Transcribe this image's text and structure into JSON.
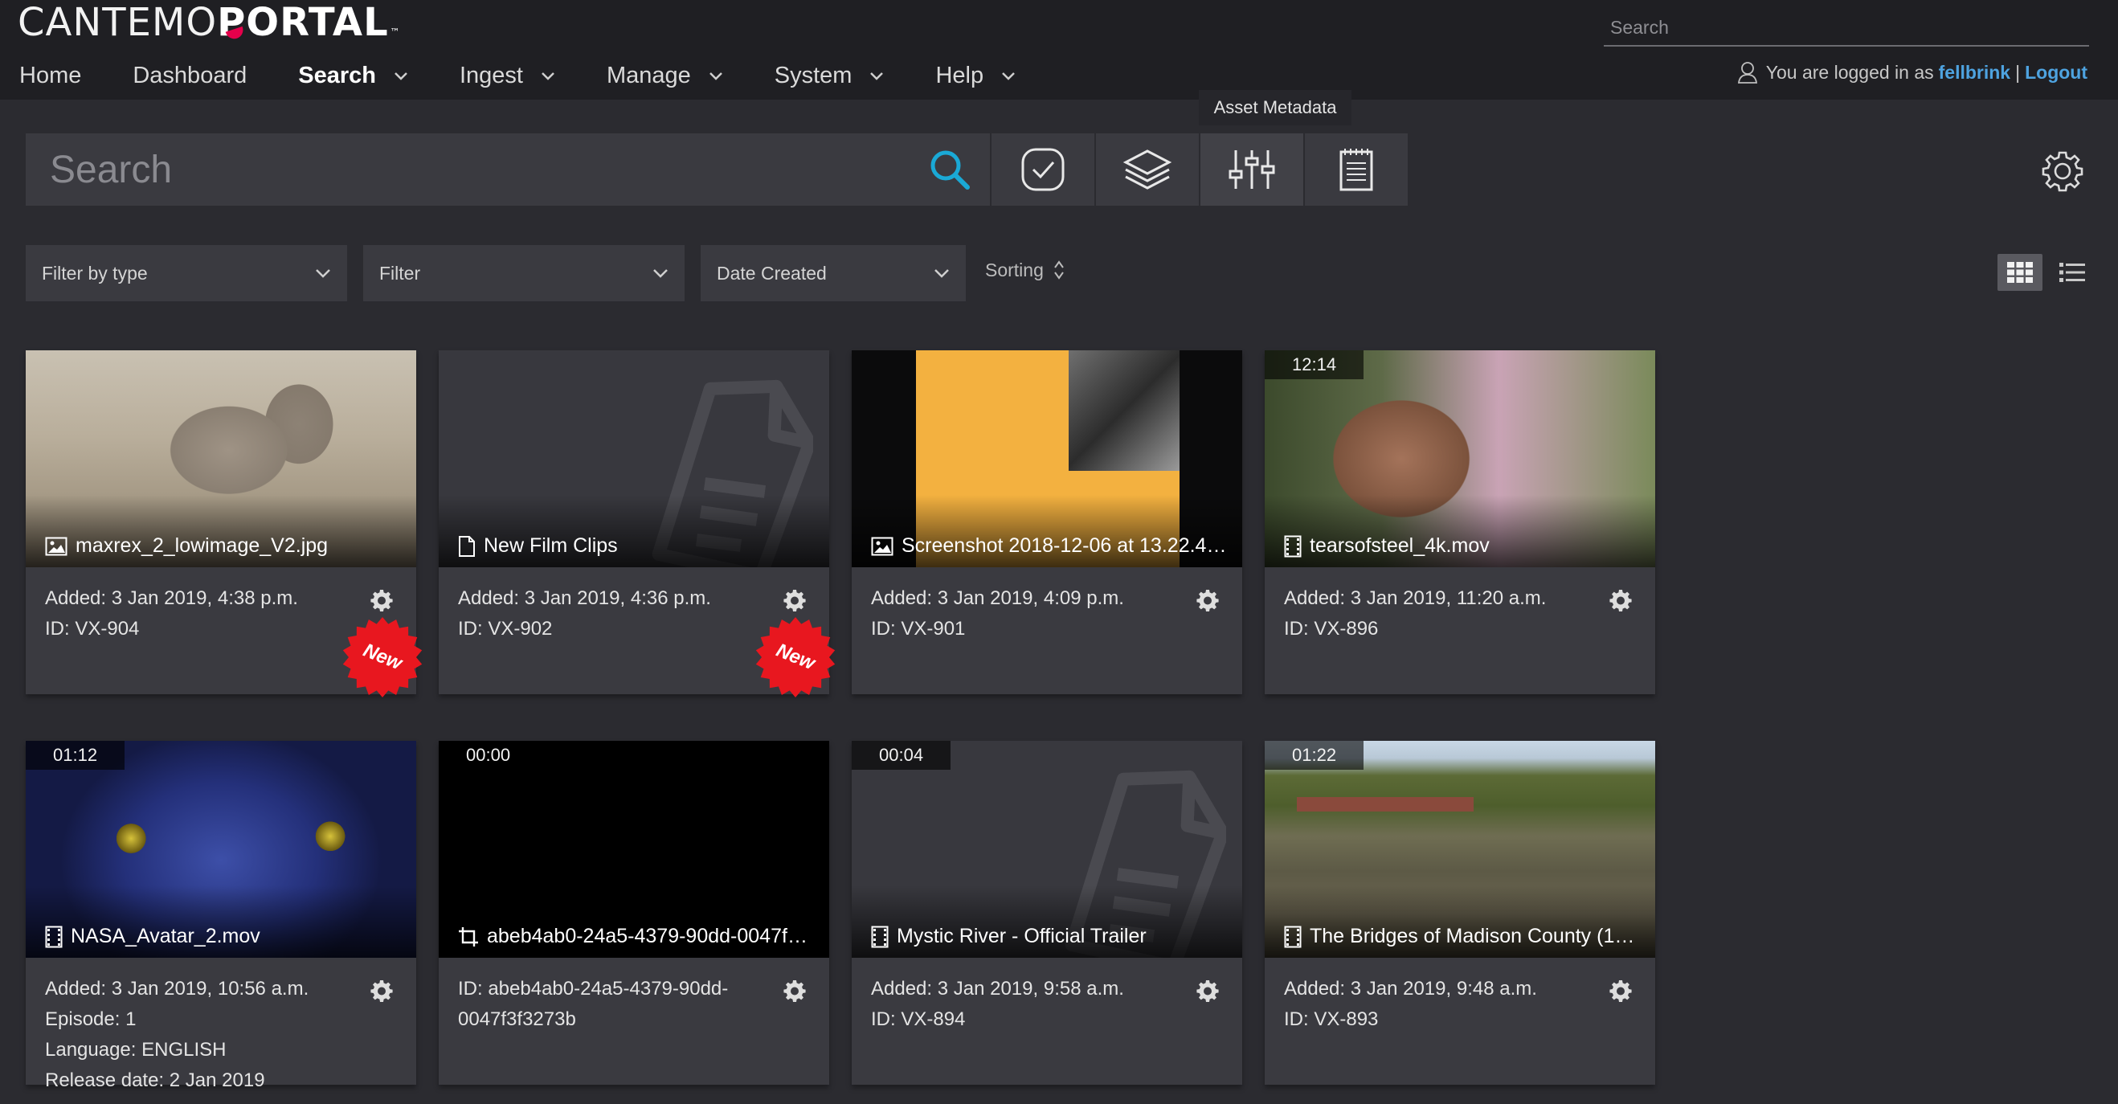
{
  "brand": {
    "thin": "CANTEMO",
    "bold": "PORTAL",
    "tm": "™"
  },
  "header": {
    "search_placeholder": "Search",
    "nav": [
      {
        "label": "Home",
        "dropdown": false,
        "active": false
      },
      {
        "label": "Dashboard",
        "dropdown": false,
        "active": false
      },
      {
        "label": "Search",
        "dropdown": true,
        "active": true
      },
      {
        "label": "Ingest",
        "dropdown": true,
        "active": false
      },
      {
        "label": "Manage",
        "dropdown": true,
        "active": false
      },
      {
        "label": "System",
        "dropdown": true,
        "active": false
      },
      {
        "label": "Help",
        "dropdown": true,
        "active": false
      }
    ],
    "user": {
      "prefix": "You are logged in as",
      "username": "fellbrink",
      "separator": "|",
      "logout": "Logout"
    }
  },
  "search": {
    "placeholder": "Search",
    "tooltip": "Asset Metadata",
    "toolbar": [
      "check-circle-icon",
      "layers-icon",
      "sliders-icon",
      "notepad-icon"
    ]
  },
  "filters": {
    "type": "Filter by type",
    "filter": "Filter",
    "date": "Date Created",
    "sorting": "Sorting"
  },
  "cards": [
    {
      "title": "maxrex_2_lowimage_V2.jpg",
      "type": "image",
      "duration": "",
      "art": "elephant",
      "meta": [
        "Added: 3 Jan 2019, 4:38 p.m.",
        "ID: VX-904"
      ],
      "is_new": true,
      "new_label": "New"
    },
    {
      "title": "New Film Clips",
      "type": "document",
      "duration": "",
      "art": "doc",
      "meta": [
        "Added: 3 Jan 2019, 4:36 p.m.",
        "ID: VX-902"
      ],
      "is_new": true,
      "new_label": "New"
    },
    {
      "title": "Screenshot 2018-12-06 at 13.22.48.p...",
      "type": "image",
      "duration": "",
      "art": "odz",
      "meta": [
        "Added: 3 Jan 2019, 4:09 p.m.",
        "ID: VX-901"
      ],
      "is_new": false,
      "new_label": ""
    },
    {
      "title": "tearsofsteel_4k.mov",
      "type": "video",
      "duration": "12:14",
      "art": "steel",
      "meta": [
        "Added: 3 Jan 2019, 11:20 a.m.",
        "ID: VX-896"
      ],
      "is_new": false,
      "new_label": ""
    },
    {
      "title": "NASA_Avatar_2.mov",
      "type": "video",
      "duration": "01:12",
      "art": "avatar",
      "meta": [
        "Added: 3 Jan 2019, 10:56 a.m.",
        "Episode: 1",
        "Language: ENGLISH",
        "Release date: 2 Jan 2019"
      ],
      "is_new": false,
      "new_label": ""
    },
    {
      "title": "abeb4ab0-24a5-4379-90dd-0047f3f...",
      "type": "crop",
      "duration": "00:00",
      "art": "black",
      "meta": [
        "ID: abeb4ab0-24a5-4379-90dd-",
        "0047f3f3273b"
      ],
      "is_new": false,
      "new_label": ""
    },
    {
      "title": "Mystic River - Official Trailer",
      "type": "video",
      "duration": "00:04",
      "art": "doc",
      "meta": [
        "Added: 3 Jan 2019, 9:58 a.m.",
        "ID: VX-894"
      ],
      "is_new": false,
      "new_label": ""
    },
    {
      "title": "The Bridges of Madison County (199...",
      "type": "video",
      "duration": "01:22",
      "art": "bridge",
      "meta": [
        "Added: 3 Jan 2019, 9:48 a.m.",
        "ID: VX-893"
      ],
      "is_new": false,
      "new_label": ""
    }
  ],
  "colors": {
    "accent": "#4ea3e0",
    "search_icon": "#1aa9d6",
    "new_badge": "#e8171f",
    "background": "#2b2b30",
    "card": "#3a3a40"
  }
}
